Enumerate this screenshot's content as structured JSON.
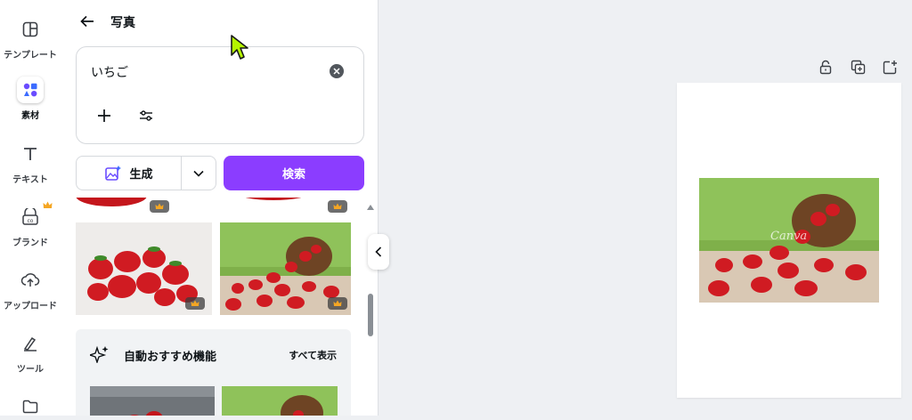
{
  "rail": {
    "items": [
      {
        "label": "テンプレート",
        "icon": "template-icon"
      },
      {
        "label": "素材",
        "icon": "elements-icon"
      },
      {
        "label": "テキスト",
        "icon": "text-icon"
      },
      {
        "label": "ブランド",
        "icon": "brand-icon"
      },
      {
        "label": "アップロード",
        "icon": "upload-icon"
      },
      {
        "label": "ツール",
        "icon": "tools-icon"
      },
      {
        "label": "",
        "icon": "projects-folder-icon"
      }
    ]
  },
  "panel": {
    "title": "写真",
    "search_value": "いちご",
    "generate_label": "生成",
    "search_button": "検索",
    "auto_section": {
      "title": "自動おすすめ機能",
      "see_all": "すべて表示"
    }
  },
  "colors": {
    "accent": "#8b3dff",
    "cursor": "#b5f500"
  }
}
